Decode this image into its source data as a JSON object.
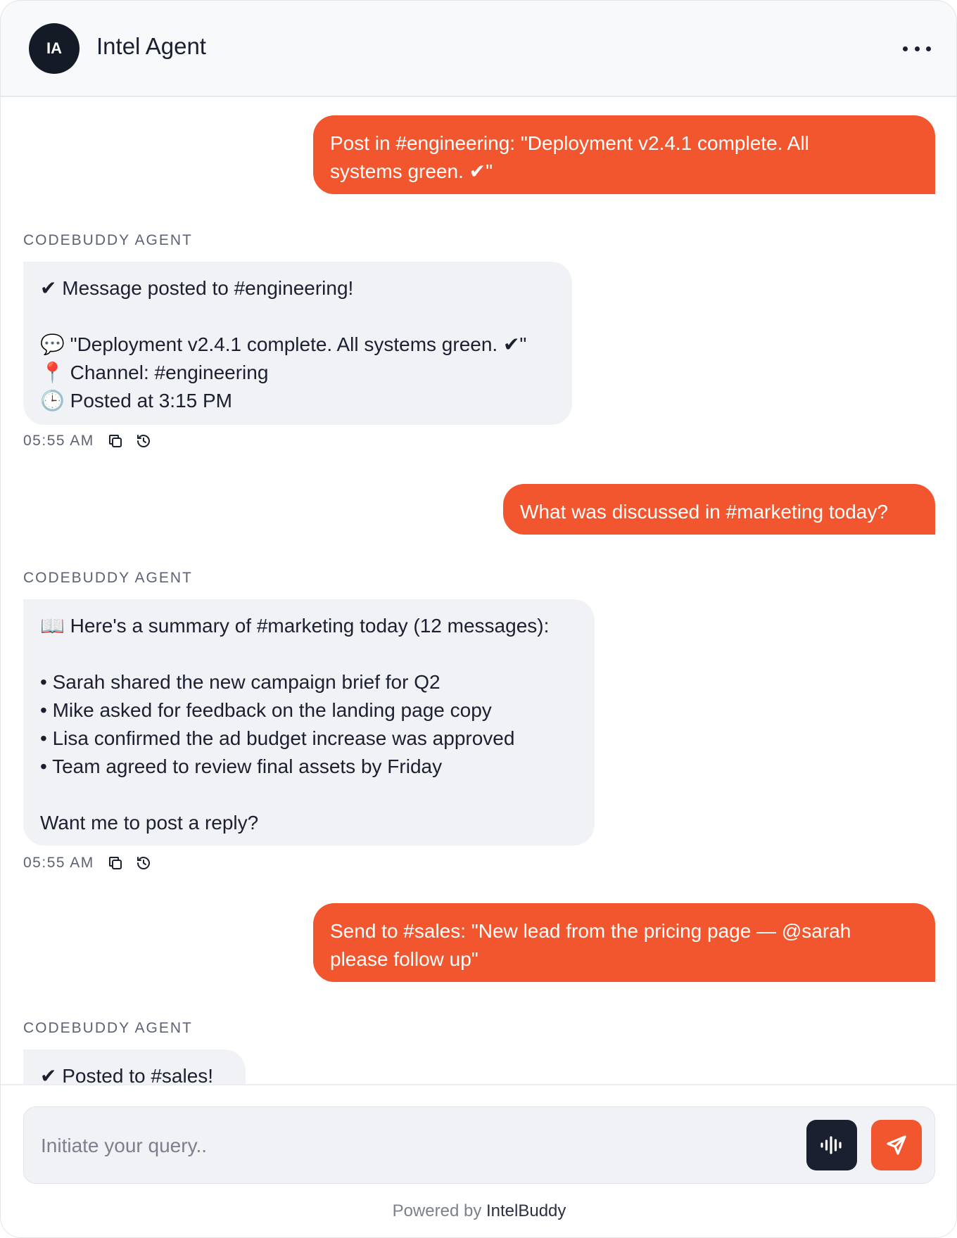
{
  "header": {
    "avatar_initials": "IA",
    "title": "Intel Agent",
    "menu_icon": "more-horizontal-icon"
  },
  "messages": [
    {
      "role": "user",
      "text": "Post in #engineering: \"Deployment v2.4.1 complete. All\nsystems green. ✔\""
    },
    {
      "role": "agent",
      "sender": "CODEBUDDY AGENT",
      "text": "✔ Message posted to #engineering!\n\n💬 \"Deployment v2.4.1 complete. All systems green. ✔\"\n📍 Channel: #engineering\n🕒 Posted at 3:15 PM",
      "time": "05:55 AM"
    },
    {
      "role": "user",
      "text": "What was discussed in #marketing today?"
    },
    {
      "role": "agent",
      "sender": "CODEBUDDY AGENT",
      "text": "📖 Here's a summary of #marketing today (12 messages):\n\n• Sarah shared the new campaign brief for Q2\n• Mike asked for feedback on the landing page copy\n• Lisa confirmed the ad budget increase was approved\n• Team agreed to review final assets by Friday\n\nWant me to post a reply?",
      "time": "05:55 AM"
    },
    {
      "role": "user",
      "text": "Send to #sales: \"New lead from the pricing page — @sarah\nplease follow up\""
    },
    {
      "role": "agent",
      "sender": "CODEBUDDY AGENT",
      "text": "✔ Posted to #sales!"
    }
  ],
  "composer": {
    "placeholder": "Initiate your query..",
    "voice_icon": "audio-waveform-icon",
    "send_icon": "send-icon"
  },
  "footer": {
    "prefix": "Powered by ",
    "brand": "IntelBuddy"
  },
  "colors": {
    "accent": "#f2562e",
    "dark": "#1b2030",
    "agent_bubble": "#f1f2f6"
  }
}
